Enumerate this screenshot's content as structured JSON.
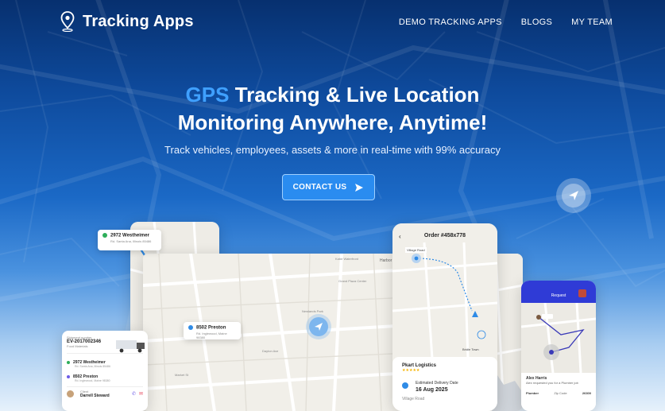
{
  "nav": {
    "logo_text": "Tracking Apps",
    "links": [
      "DEMO TRACKING APPS",
      "BLOGS",
      "MY TEAM"
    ]
  },
  "hero": {
    "headline_accent": "GPS",
    "headline_line1_rest": " Tracking & Live Location",
    "headline_line2": "Monitoring Anywhere, Anytime!",
    "subtitle": "Track vehicles, employees, assets & more in real-time with 99% accuracy",
    "cta_label": "CONTACT US"
  },
  "tablet": {
    "popup_start": {
      "title": "2972 Westheimer",
      "subtitle": "Rd. Santa Ana, Illinois 85486"
    },
    "popup_end": {
      "title": "8502 Preston",
      "subtitle": "Rd. Inglewood, Maine 98380"
    }
  },
  "laptop": {
    "map_labels": [
      "Kabe Waterfront",
      "Harbor",
      "Grand Plaza Center",
      "Newlands Park",
      "Dayton Ave",
      "Market St"
    ]
  },
  "phone1": {
    "title": "Order #458x778",
    "map_pin_label": "Village Road",
    "map_end_label": "Bridle Town",
    "company": "Pkart Logistics",
    "rating": "★★★★★",
    "delivery_label": "Estimated Delivery Date",
    "delivery_date": "16 Aug 2025",
    "address": "Village Road"
  },
  "phone3": {
    "header": "Request",
    "person": "Alex Harris",
    "request_text": "Alex requested you for a Plumber job",
    "rows": [
      {
        "label": "Plumber",
        "value": "Zip Code",
        "extra": "26300"
      }
    ]
  },
  "shipcard": {
    "label": "Shipment number",
    "id": "EV-2017002346",
    "type": "Food Materials",
    "stops": [
      {
        "title": "2972 Westheimer",
        "sub": "Rd. Santa Ana, Illinois 85486"
      },
      {
        "title": "8502 Preston",
        "sub": "Rd. Inglewood, Maine 98380"
      }
    ],
    "client_label": "Client",
    "client_name": "Darrell Steward"
  },
  "colors": {
    "accent": "#3fa0ff",
    "cta": "#2a8cf0",
    "phone3_header": "#2f3bd6",
    "route": "#2f8be6"
  }
}
